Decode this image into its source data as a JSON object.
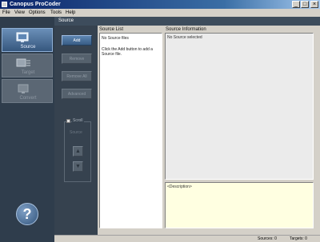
{
  "window": {
    "title": "Canopus ProCoder",
    "controls": {
      "minimize": "_",
      "maximize": "□",
      "close": "×"
    }
  },
  "menu": [
    "File",
    "View",
    "Options",
    "Tools",
    "Help"
  ],
  "nav": {
    "items": [
      {
        "label": "Source",
        "icon": "source-monitor-icon",
        "state": "active"
      },
      {
        "label": "Target",
        "icon": "target-icon",
        "state": "inactive"
      },
      {
        "label": "Convert",
        "icon": "convert-icon",
        "state": "inactive"
      }
    ],
    "help_label": "?"
  },
  "section": {
    "title": "Source"
  },
  "actions": {
    "add": "Add",
    "remove": "Remove",
    "remove_all": "Remove All",
    "advanced": "Advanced",
    "scroll_label": "Scroll",
    "scroll_sub": "Source",
    "up": "▲",
    "down": "▼"
  },
  "source_list": {
    "title": "Source List",
    "empty_text": "No Source files",
    "hint": "Click the Add button to add a Source file."
  },
  "source_info": {
    "title": "Source Information",
    "empty_text": "No Source selected"
  },
  "description": {
    "text": "<Description>"
  },
  "status": {
    "sources": "Sources: 0",
    "targets": "Targets: 0"
  },
  "colors": {
    "titlebar": "#0a246a",
    "nav_bg": "#2f3d4c",
    "nav_active": "#4f7299",
    "description_bg": "#ffffe1"
  }
}
